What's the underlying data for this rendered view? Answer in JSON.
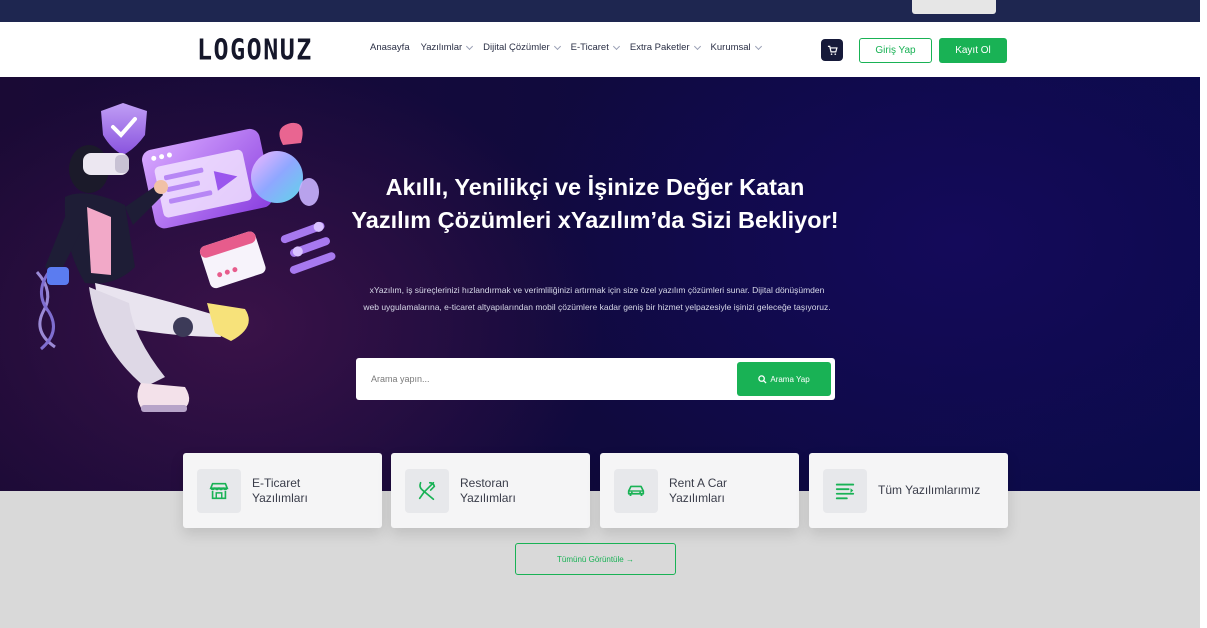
{
  "brand": {
    "logo_text": "LOGONUZ"
  },
  "nav": {
    "items": [
      {
        "label": "Anasayfa",
        "has_dropdown": false
      },
      {
        "label": "Yazılımlar",
        "has_dropdown": true
      },
      {
        "label": "Dijital Çözümler",
        "has_dropdown": true
      },
      {
        "label": "E-Ticaret",
        "has_dropdown": true
      },
      {
        "label": "Extra Paketler",
        "has_dropdown": true
      },
      {
        "label": "Kurumsal",
        "has_dropdown": true
      }
    ],
    "cart_icon": "cart-icon",
    "login_label": "Giriş Yap",
    "register_label": "Kayıt Ol"
  },
  "hero": {
    "title": "Akıllı, Yenilikçi ve İşinize Değer Katan Yazılım Çözümleri xYazılım’da Sizi Bekliyor!",
    "description": "xYazılım, iş süreçlerinizi hızlandırmak ve verimliliğinizi artırmak için size özel yazılım çözümleri sunar. Dijital dönüşümden web uygulamalarına, e-ticaret altyapılarından mobil çözümlere kadar geniş bir hizmet yelpazesiyle işinizi geleceğe taşıyoruz.",
    "search_placeholder": "Arama yapın...",
    "search_button": "Arama Yap"
  },
  "categories": [
    {
      "label": "E-Ticaret\nYazılımları",
      "icon": "store-icon"
    },
    {
      "label": "Restoran\nYazılımları",
      "icon": "utensils-icon"
    },
    {
      "label": "Rent A Car\nYazılımları",
      "icon": "car-icon"
    },
    {
      "label": "Tüm Yazılımlarımız",
      "icon": "list-icon"
    }
  ],
  "view_all_label": "Tümünü Görüntüle →",
  "colors": {
    "accent": "#19b255",
    "topbar": "#1e2650",
    "hero_dark": "#100a3e",
    "navy_button": "#161a3a"
  }
}
